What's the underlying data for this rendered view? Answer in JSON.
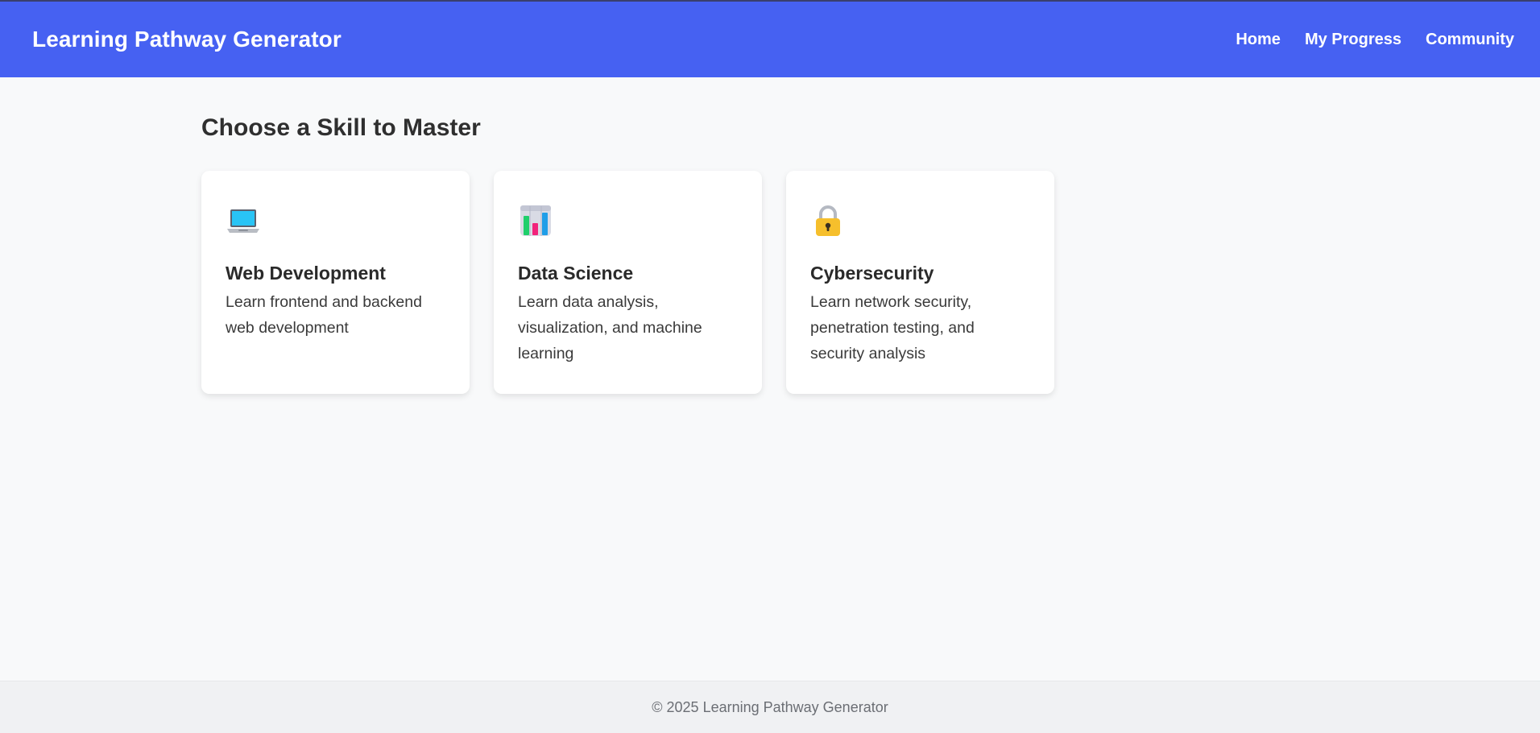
{
  "header": {
    "title": "Learning Pathway Generator",
    "nav": [
      {
        "label": "Home"
      },
      {
        "label": "My Progress"
      },
      {
        "label": "Community"
      }
    ],
    "background_color": "#4661f2"
  },
  "main": {
    "title": "Choose a Skill to Master",
    "skills": [
      {
        "icon": "laptop-icon",
        "title": "Web Development",
        "description": "Learn frontend and backend web development"
      },
      {
        "icon": "bar-chart-icon",
        "title": "Data Science",
        "description": "Learn data analysis, visualization, and machine learning"
      },
      {
        "icon": "lock-icon",
        "title": "Cybersecurity",
        "description": "Learn network security, penetration testing, and security analysis"
      }
    ]
  },
  "footer": {
    "text": "© 2025 Learning Pathway Generator"
  }
}
